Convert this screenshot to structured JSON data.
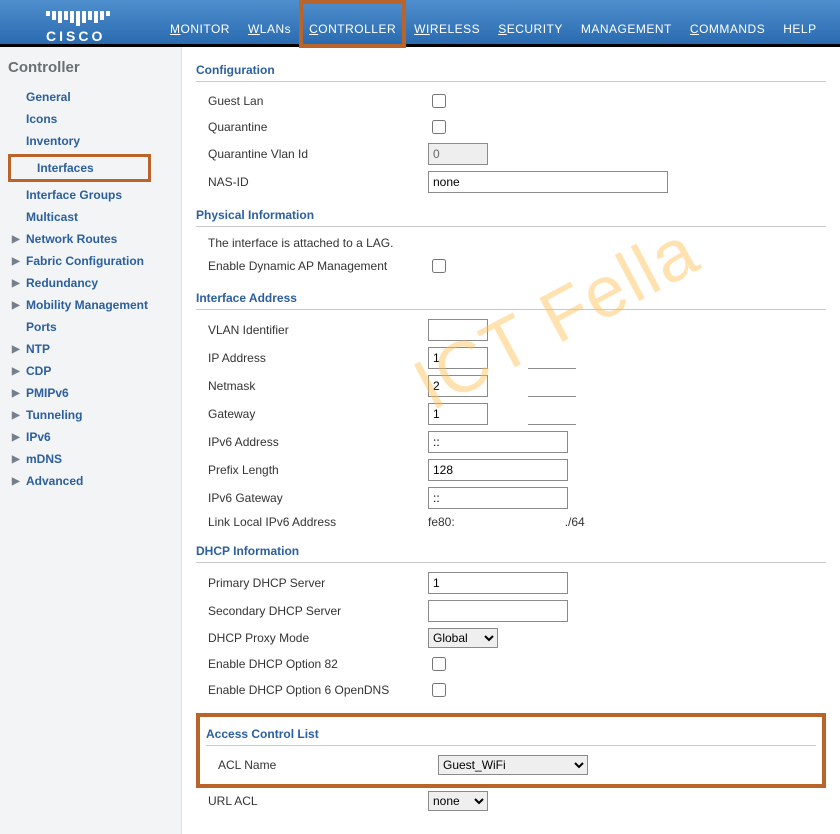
{
  "brand": "CISCO",
  "watermark": "ICT Fella",
  "topnav": {
    "items": [
      {
        "key": "M",
        "rest": "ONITOR"
      },
      {
        "key": "W",
        "rest": "LANs"
      },
      {
        "key": "C",
        "rest": "ONTROLLER"
      },
      {
        "key": "WI",
        "rest": "RELESS"
      },
      {
        "key": "S",
        "rest": "ECURITY"
      },
      {
        "key": "",
        "rest": "MANAGEMENT"
      },
      {
        "key": "C",
        "rest": "OMMANDS"
      },
      {
        "key": "",
        "rest": "HELP"
      }
    ],
    "highlight_index": 2
  },
  "sidebar": {
    "title": "Controller",
    "items": [
      {
        "label": "General",
        "expandable": false
      },
      {
        "label": "Icons",
        "expandable": false
      },
      {
        "label": "Inventory",
        "expandable": false
      },
      {
        "label": "Interfaces",
        "expandable": false,
        "highlighted": true
      },
      {
        "label": "Interface Groups",
        "expandable": false
      },
      {
        "label": "Multicast",
        "expandable": false
      },
      {
        "label": "Network Routes",
        "expandable": true
      },
      {
        "label": "Fabric Configuration",
        "expandable": true
      },
      {
        "label": "Redundancy",
        "expandable": true
      },
      {
        "label": "Mobility Management",
        "expandable": true
      },
      {
        "label": "Ports",
        "expandable": false
      },
      {
        "label": "NTP",
        "expandable": true
      },
      {
        "label": "CDP",
        "expandable": true
      },
      {
        "label": "PMIPv6",
        "expandable": true
      },
      {
        "label": "Tunneling",
        "expandable": true
      },
      {
        "label": "IPv6",
        "expandable": true
      },
      {
        "label": "mDNS",
        "expandable": true
      },
      {
        "label": "Advanced",
        "expandable": true
      }
    ]
  },
  "sections": {
    "configuration": {
      "title": "Configuration",
      "guest_lan_label": "Guest Lan",
      "quarantine_label": "Quarantine",
      "quarantine_vlan_label": "Quarantine Vlan Id",
      "quarantine_vlan_value": "0",
      "nas_id_label": "NAS-ID",
      "nas_id_value": "none"
    },
    "physical": {
      "title": "Physical Information",
      "lag_text": "The interface is attached to a LAG.",
      "enable_dyn_ap_label": "Enable Dynamic AP Management"
    },
    "iface": {
      "title": "Interface Address",
      "vlan_label": "VLAN Identifier",
      "vlan_value": "",
      "ip_label": "IP Address",
      "ip_value": "1",
      "netmask_label": "Netmask",
      "netmask_value": "2",
      "gateway_label": "Gateway",
      "gateway_value": "1",
      "ipv6_addr_label": "IPv6 Address",
      "ipv6_addr_value": "::",
      "prefix_label": "Prefix Length",
      "prefix_value": "128",
      "ipv6_gw_label": "IPv6 Gateway",
      "ipv6_gw_value": "::",
      "linklocal_label": "Link Local IPv6 Address",
      "linklocal_a": "fe80:",
      "linklocal_b": "./64"
    },
    "dhcp": {
      "title": "DHCP Information",
      "primary_label": "Primary DHCP Server",
      "primary_value": "1",
      "secondary_label": "Secondary DHCP Server",
      "secondary_value": "",
      "proxy_label": "DHCP Proxy Mode",
      "proxy_value": "Global",
      "opt82_label": "Enable DHCP Option 82",
      "opt6_label": "Enable DHCP Option 6 OpenDNS"
    },
    "acl": {
      "title": "Access Control List",
      "name_label": "ACL Name",
      "name_value": "Guest_WiFi",
      "url_label": "URL ACL",
      "url_value": "none"
    }
  }
}
